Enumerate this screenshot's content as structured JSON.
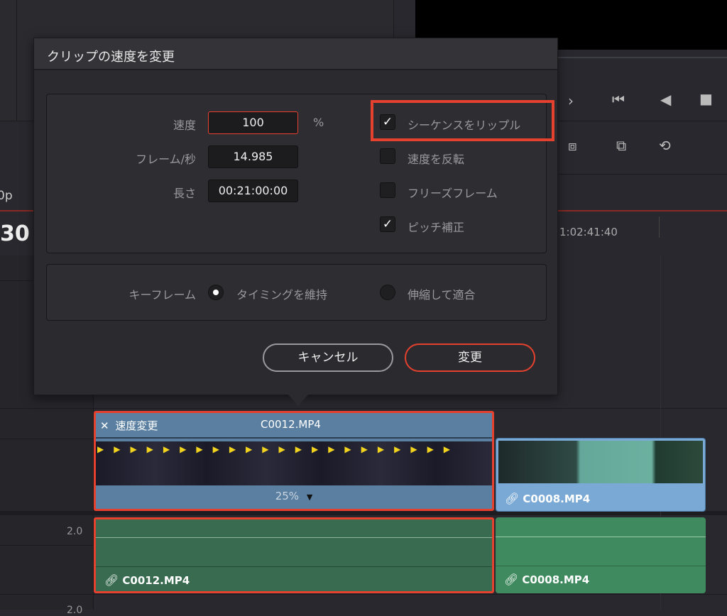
{
  "dialog": {
    "title": "クリップの速度を変更",
    "speed_label": "速度",
    "speed_value": "100",
    "speed_unit": "%",
    "fps_label": "フレーム/秒",
    "fps_value": "14.985",
    "duration_label": "長さ",
    "duration_value": "00:21:00:00",
    "checkboxes": [
      {
        "label": "シーケンスをリップル",
        "checked": true
      },
      {
        "label": "速度を反転",
        "checked": false
      },
      {
        "label": "フリーズフレーム",
        "checked": false
      },
      {
        "label": "ピッチ補正",
        "checked": true
      }
    ],
    "keyframe_label": "キーフレーム",
    "radio_options": [
      {
        "label": "タイミングを維持",
        "selected": true
      },
      {
        "label": "伸縮して適合",
        "selected": false
      }
    ],
    "cancel_label": "キャンセル",
    "change_label": "変更"
  },
  "background": {
    "timecode_partial": "30",
    "resolution_partial": "0p",
    "ruler_timecode": "1:02:41:40",
    "audio_level": "2.0",
    "audio_level2": "2.0"
  },
  "timeline": {
    "video_clip1": {
      "badge": "速度変更",
      "name": "C0012.MP4",
      "speed": "25%"
    },
    "video_clip2": {
      "name": "C0008.MP4"
    },
    "audio_clip1": {
      "name": "C0012.MP4"
    },
    "audio_clip2": {
      "name": "C0008.MP4"
    }
  },
  "colors": {
    "highlight": "#e5412e",
    "video_clip": "#5a7fa0",
    "video_clip2": "#79a9d4",
    "audio_clip": "#386b4f",
    "audio_clip2": "#3f8b5f"
  }
}
